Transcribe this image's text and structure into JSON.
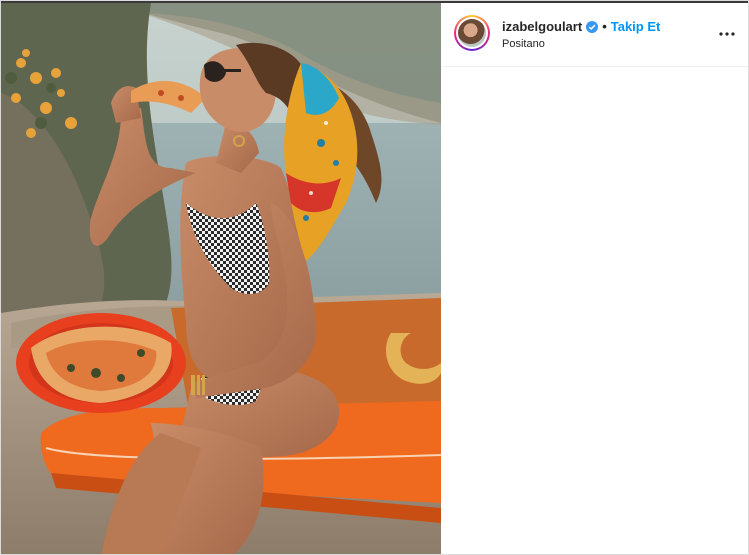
{
  "post": {
    "username": "izabelgoulart",
    "verified": true,
    "separator": "•",
    "follow_label": "Takip Et",
    "location": "Positano"
  },
  "icons": {
    "verified": "verified-badge-icon",
    "more": "more-options-icon"
  },
  "colors": {
    "follow_blue": "#0095f6",
    "text_dark": "#262626",
    "divider": "#efefef"
  }
}
